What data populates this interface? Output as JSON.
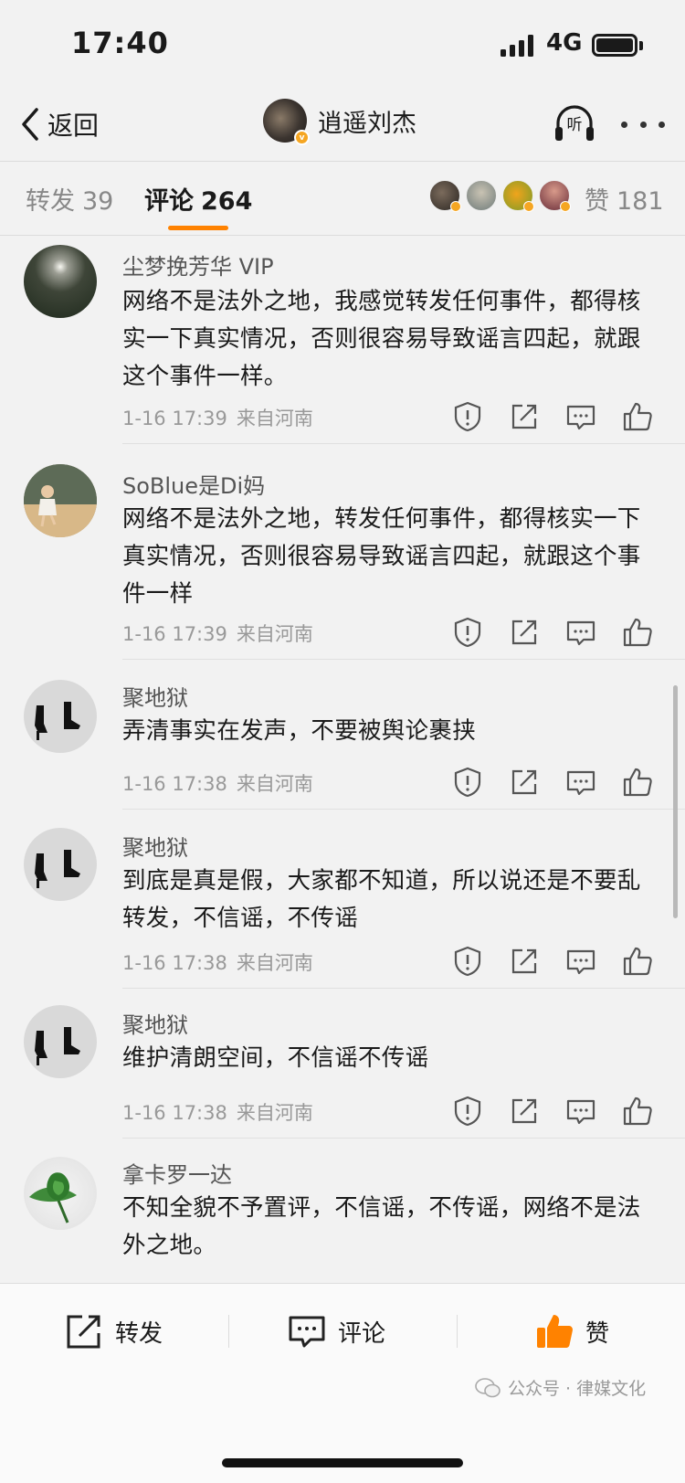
{
  "status_bar": {
    "time": "17:40",
    "network": "4G",
    "icons": [
      "signal-icon",
      "battery-icon"
    ]
  },
  "nav": {
    "back_label": "返回",
    "username": "逍遥刘杰",
    "listen_label": "听",
    "icons": [
      "chevron-left-icon",
      "verified-badge-icon",
      "headphones-icon",
      "more-icon"
    ]
  },
  "tabs": {
    "forward": {
      "label": "转发",
      "count": "39"
    },
    "comments": {
      "label": "评论",
      "count": "264"
    },
    "likes": {
      "label": "赞",
      "count": "181"
    }
  },
  "comments": [
    {
      "username": "尘梦挽芳华 VIP",
      "text": "网络不是法外之地，我感觉转发任何事件，都得核实一下真实情况，否则很容易导致谣言四起，就跟这个事件一样。",
      "time": "1-16 17:39",
      "location": "来自河南"
    },
    {
      "username": "SoBlue是Di妈",
      "text": "网络不是法外之地，转发任何事件，都得核实一下真实情况，否则很容易导致谣言四起，就跟这个事件一样",
      "time": "1-16 17:39",
      "location": "来自河南"
    },
    {
      "username": "聚地狱",
      "text": "弄清事实在发声，不要被舆论裹挟",
      "time": "1-16 17:38",
      "location": "来自河南"
    },
    {
      "username": "聚地狱",
      "text": "到底是真是假，大家都不知道，所以说还是不要乱转发，不信谣，不传谣",
      "time": "1-16 17:38",
      "location": "来自河南"
    },
    {
      "username": "聚地狱",
      "text": "维护清朗空间，不信谣不传谣",
      "time": "1-16 17:38",
      "location": "来自河南"
    },
    {
      "username": "拿卡罗一达",
      "text": "不知全貌不予置评，不信谣，不传谣，网络不是法外之地。",
      "time": "",
      "location": ""
    }
  ],
  "comment_action_icons": [
    "report-icon",
    "share-icon",
    "reply-icon",
    "like-icon"
  ],
  "bottom_bar": {
    "forward_label": "转发",
    "comment_label": "评论",
    "like_label": "赞"
  },
  "watermark": {
    "text": "公众号 · 律媒文化"
  },
  "colors": {
    "accent": "#ff8200",
    "background": "#f2f2f2",
    "verified": "#f5a623"
  }
}
